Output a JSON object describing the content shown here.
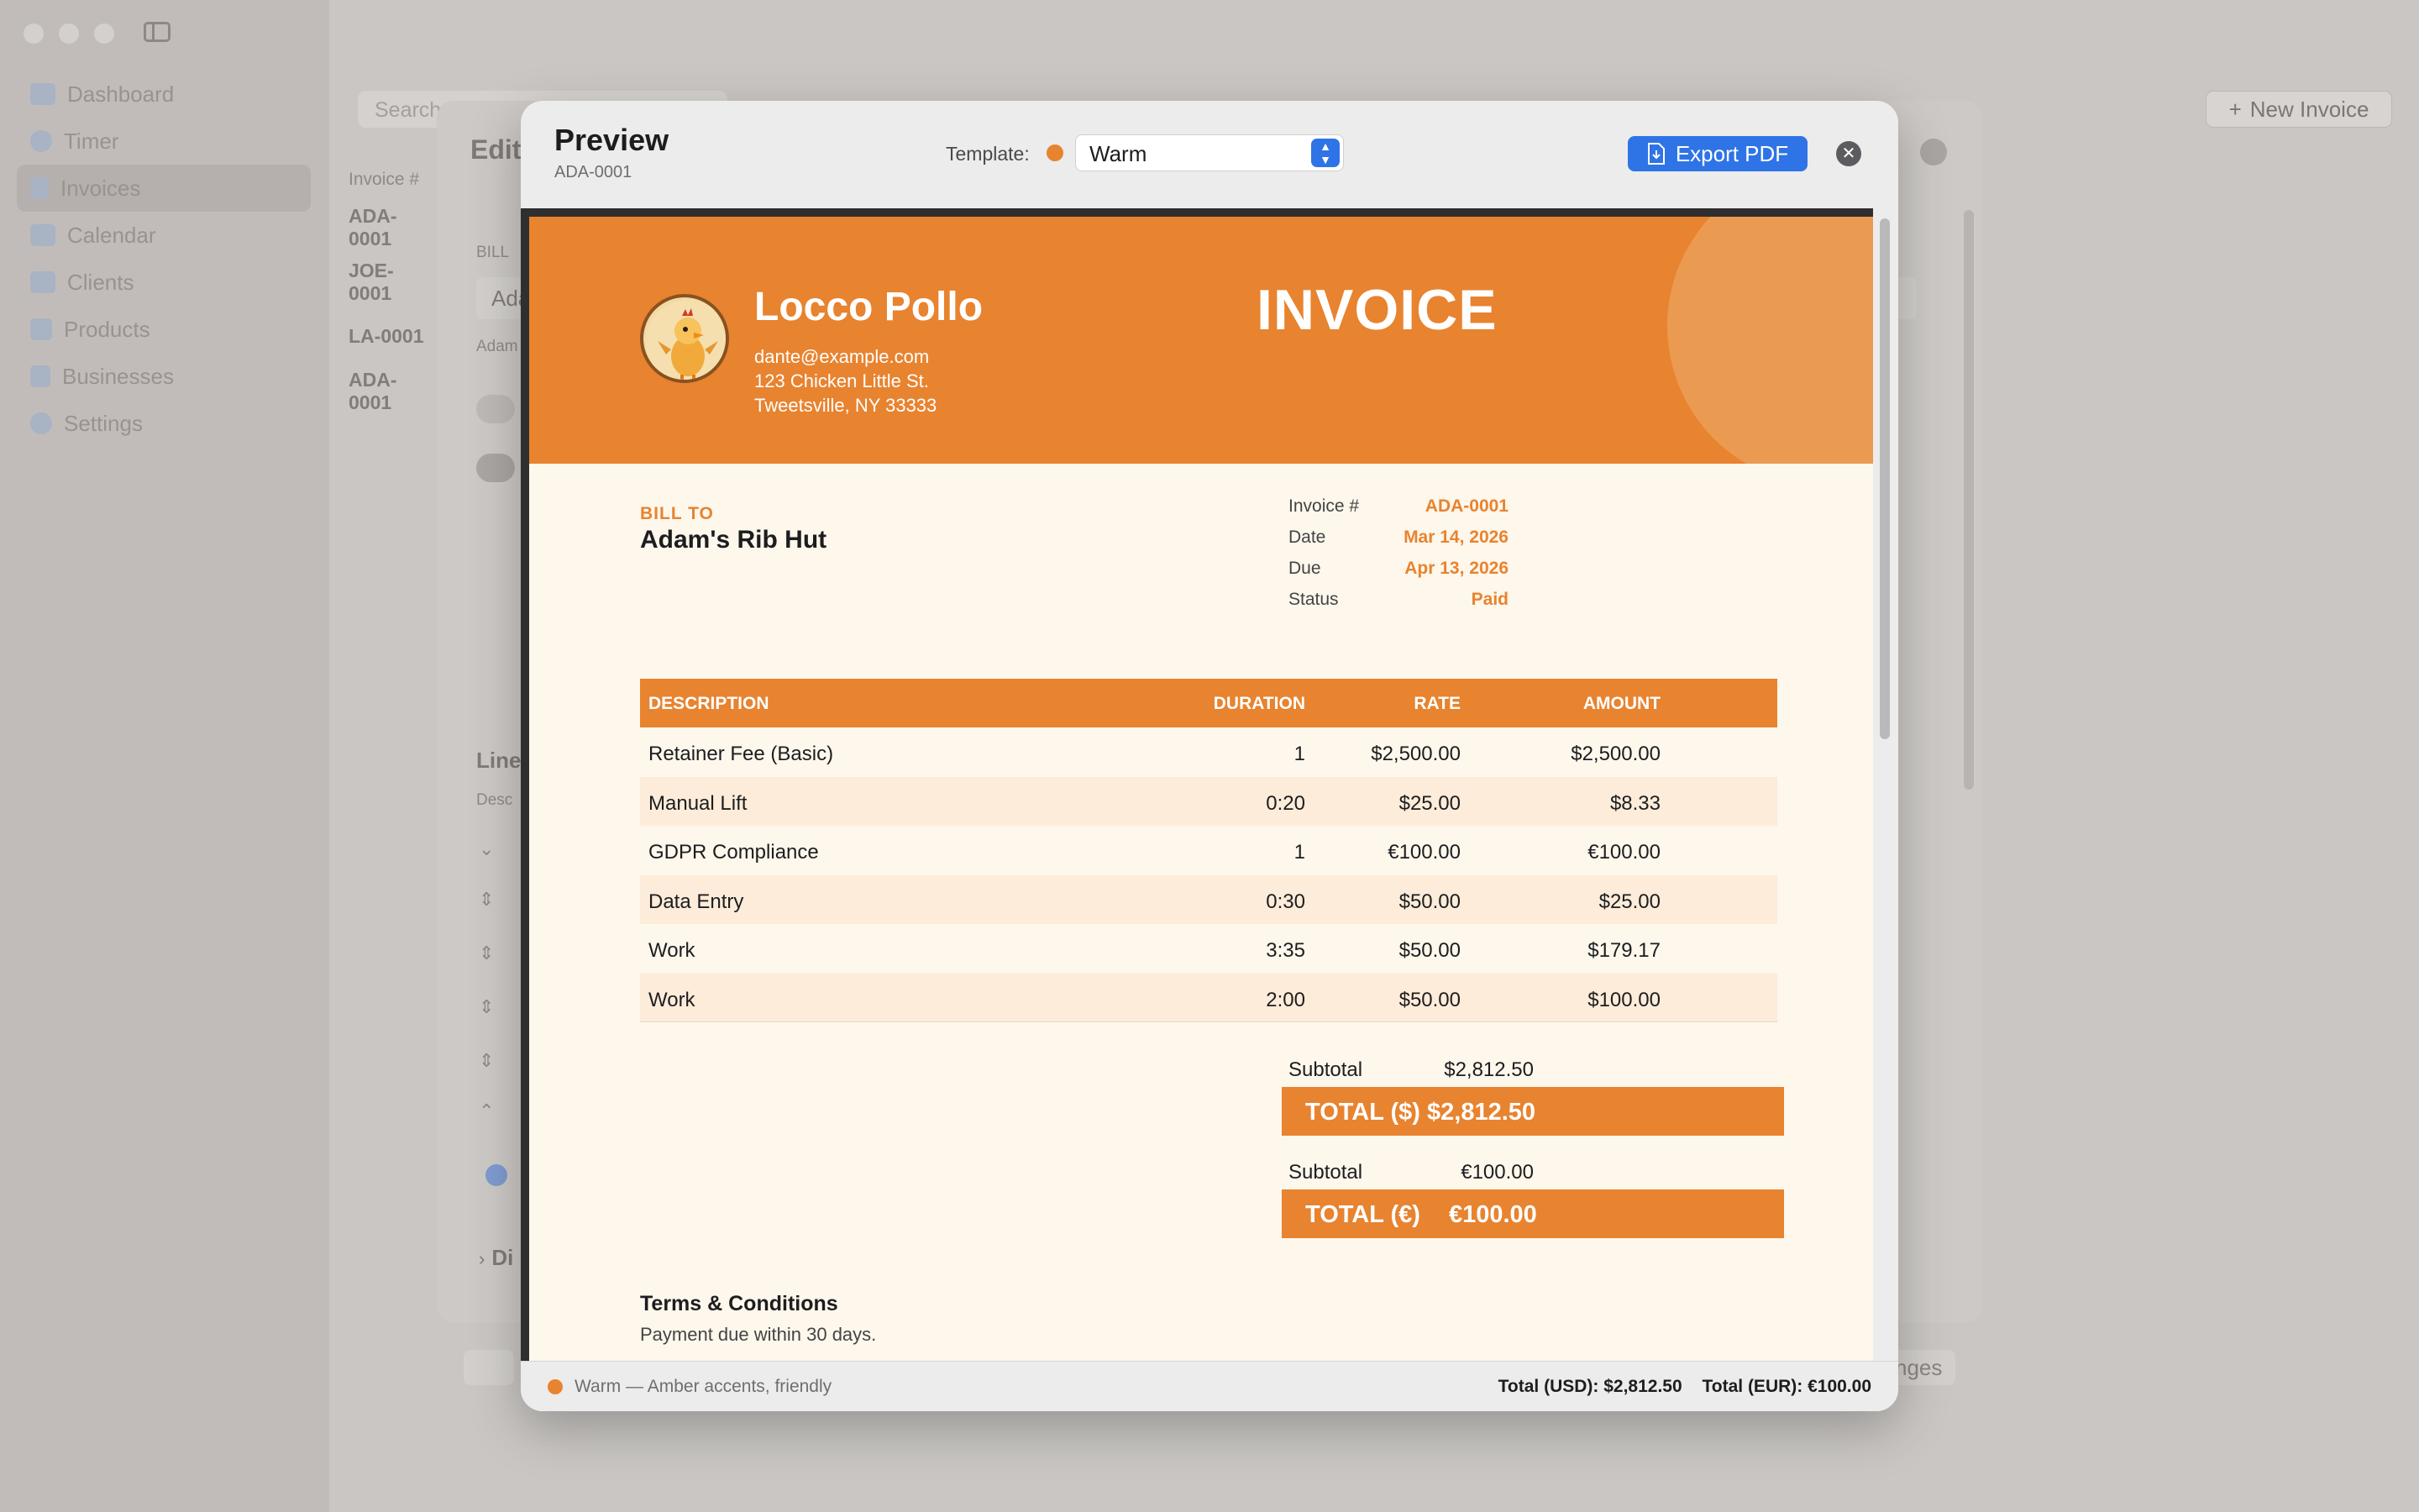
{
  "sidebar": {
    "items": [
      {
        "label": "Dashboard",
        "icon": "chart-icon"
      },
      {
        "label": "Timer",
        "icon": "clock-icon"
      },
      {
        "label": "Invoices",
        "icon": "document-icon",
        "active": true
      },
      {
        "label": "Calendar",
        "icon": "calendar-icon"
      },
      {
        "label": "Clients",
        "icon": "people-icon"
      },
      {
        "label": "Products",
        "icon": "box-icon"
      },
      {
        "label": "Businesses",
        "icon": "building-icon"
      },
      {
        "label": "Settings",
        "icon": "gear-icon"
      }
    ]
  },
  "toolbar": {
    "search_placeholder": "Search",
    "new_invoice_label": "New Invoice"
  },
  "list": {
    "header": "Invoice #",
    "rows": [
      "ADA-0001",
      "JOE-0001",
      "LA-0001",
      "ADA-0001"
    ]
  },
  "editor": {
    "title": "Edit",
    "bill_label": "BILL",
    "client_value": "Ada",
    "client_hint": "Adam",
    "lines_label": "Line",
    "lines_sub": "Desc",
    "disc_label": "Di",
    "save_label": "nges"
  },
  "preview": {
    "title": "Preview",
    "subtitle": "ADA-0001",
    "template_label": "Template:",
    "template_value": "Warm",
    "export_label": "Export PDF",
    "accent_color": "#e8832f"
  },
  "invoice": {
    "company": "Locco Pollo",
    "email": "dante@example.com",
    "address1": "123 Chicken Little St.",
    "address2": "Tweetsville, NY 33333",
    "heading": "INVOICE",
    "bill_to_label": "BILL TO",
    "bill_to_name": "Adam's Rib Hut",
    "meta": [
      {
        "k": "Invoice #",
        "v": "ADA-0001"
      },
      {
        "k": "Date",
        "v": "Mar 14, 2026"
      },
      {
        "k": "Due",
        "v": "Apr 13, 2026"
      },
      {
        "k": "Status",
        "v": "Paid"
      }
    ],
    "columns": [
      "DESCRIPTION",
      "DURATION",
      "RATE",
      "AMOUNT"
    ],
    "rows": [
      {
        "desc": "Retainer Fee (Basic)",
        "dur": "1",
        "rate": "$2,500.00",
        "amt": "$2,500.00"
      },
      {
        "desc": "Manual Lift",
        "dur": "0:20",
        "rate": "$25.00",
        "amt": "$8.33"
      },
      {
        "desc": "GDPR Compliance",
        "dur": "1",
        "rate": "€100.00",
        "amt": "€100.00"
      },
      {
        "desc": "Data Entry",
        "dur": "0:30",
        "rate": "$50.00",
        "amt": "$25.00"
      },
      {
        "desc": "Work",
        "dur": "3:35",
        "rate": "$50.00",
        "amt": "$179.17"
      },
      {
        "desc": "Work",
        "dur": "2:00",
        "rate": "$50.00",
        "amt": "$100.00"
      }
    ],
    "usd": {
      "subtotal_label": "Subtotal",
      "subtotal": "$2,812.50",
      "total_label": "TOTAL ($)",
      "total": "$2,812.50"
    },
    "eur": {
      "subtotal_label": "Subtotal",
      "subtotal": "€100.00",
      "total_label": "TOTAL (€)",
      "total": "€100.00"
    },
    "terms_title": "Terms & Conditions",
    "terms_body": "Payment due within 30 days."
  },
  "footer": {
    "template_desc": "Warm — Amber accents, friendly",
    "total_usd": "Total (USD): $2,812.50",
    "total_eur": "Total (EUR): €100.00"
  }
}
